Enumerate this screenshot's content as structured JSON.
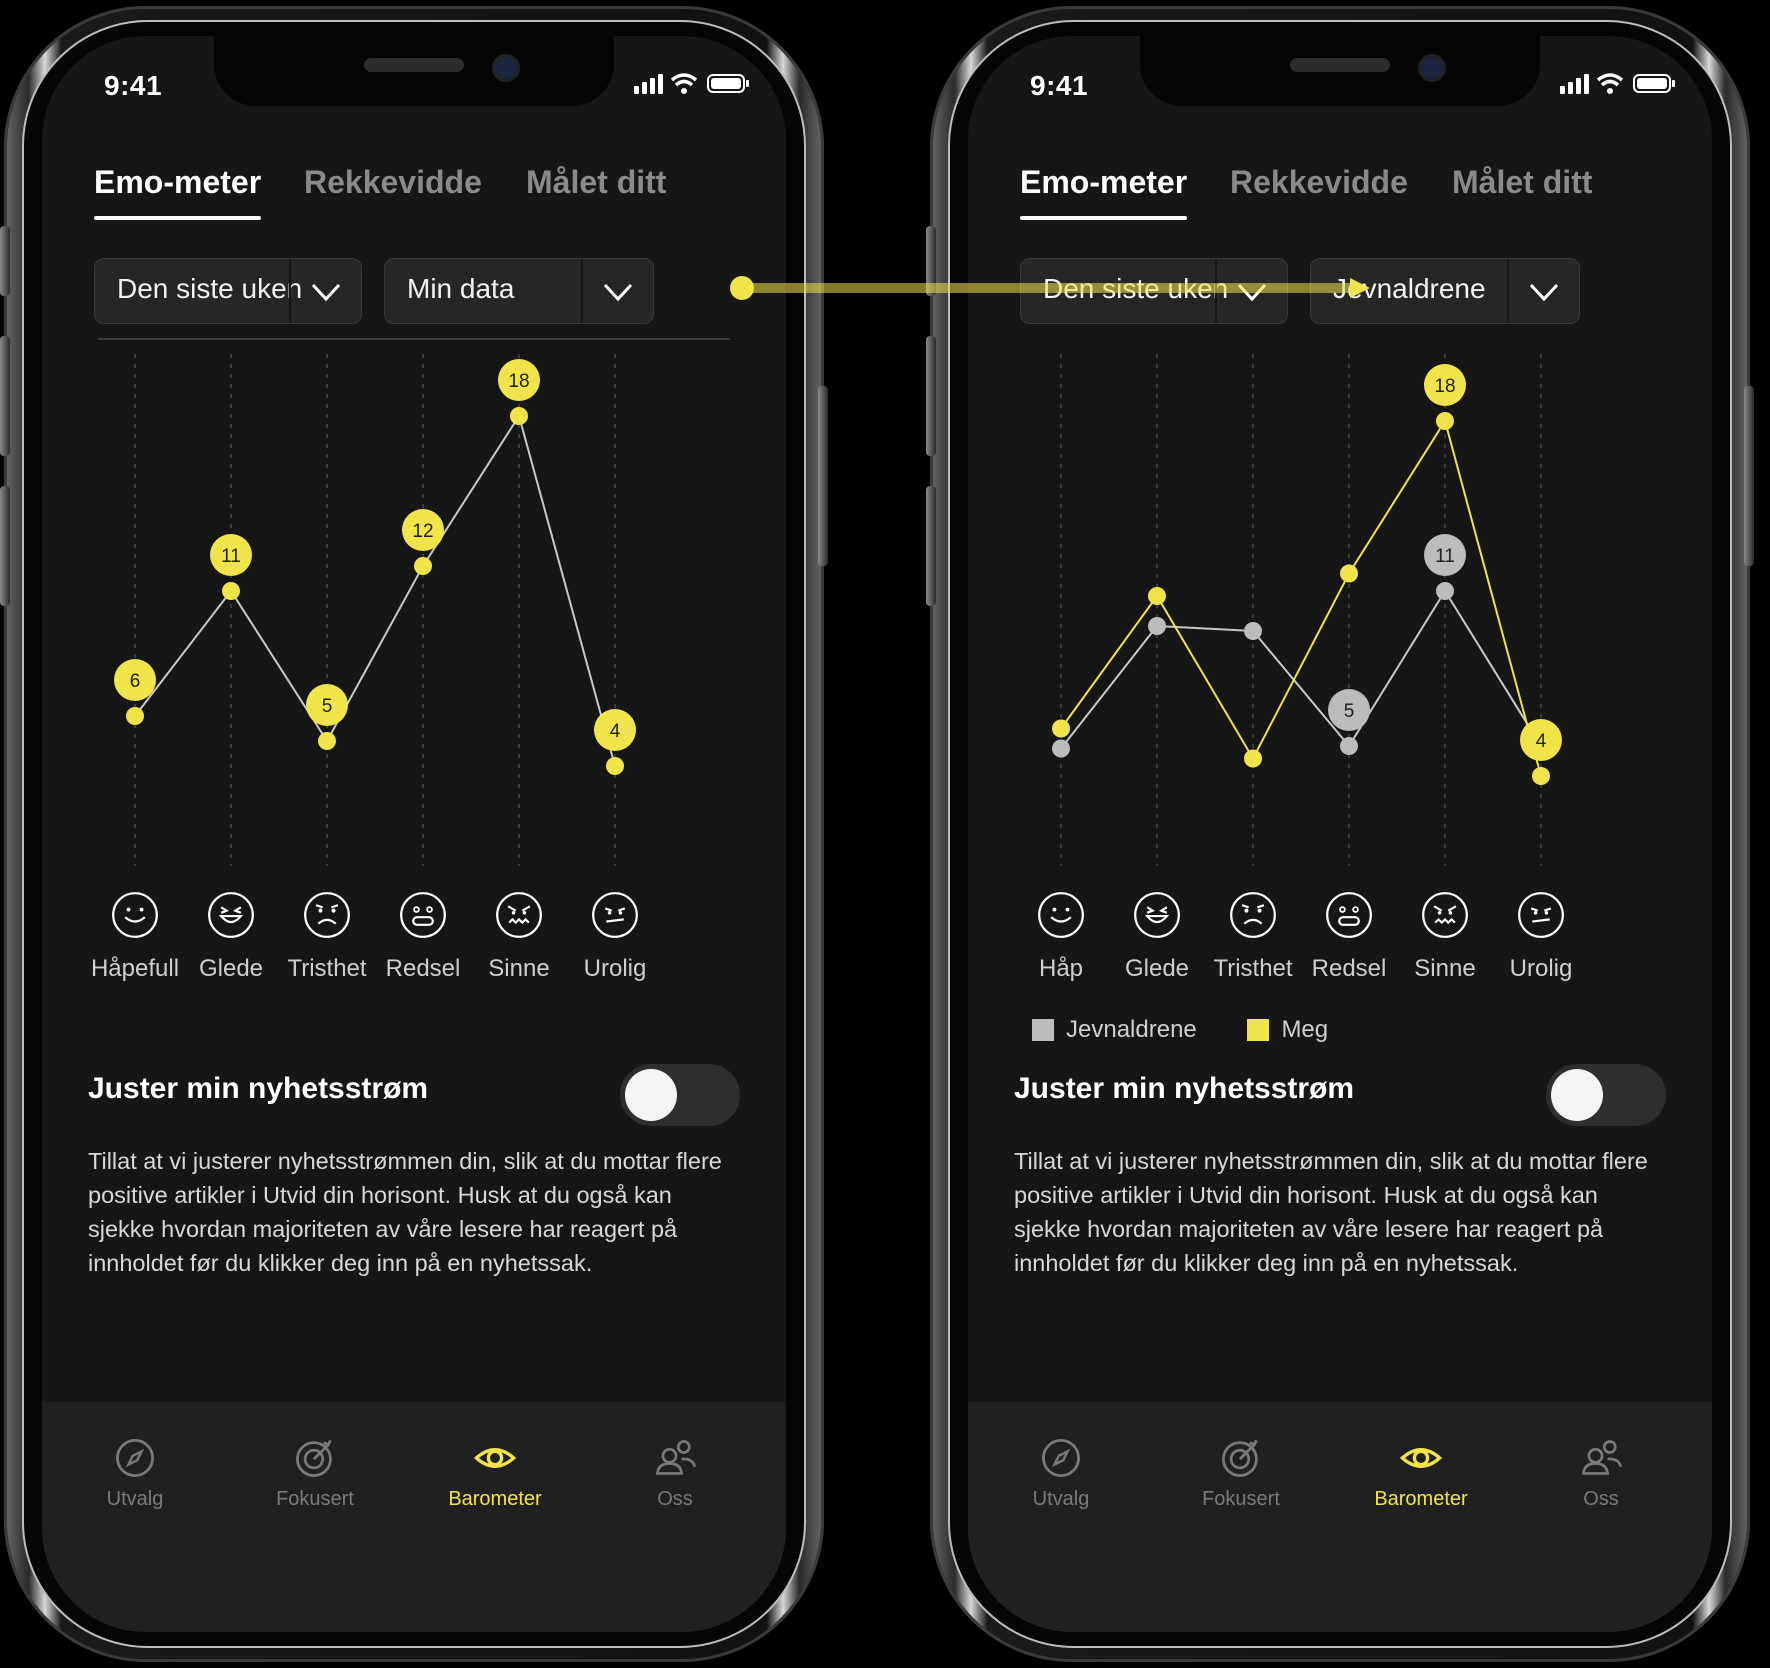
{
  "status": {
    "time": "9:41"
  },
  "tabs": [
    "Emo-meter",
    "Rekkevidde",
    "Målet ditt"
  ],
  "colors": {
    "accent": "#f0e44a",
    "peer": "#bcbcbc",
    "line": "#c8c8c8",
    "background": "#161616"
  },
  "left": {
    "period_select": "Den siste uken",
    "data_select": "Min data",
    "emotions": [
      "Håpefull",
      "Glede",
      "Tristhet",
      "Redsel",
      "Sinne",
      "Urolig"
    ],
    "emotion_icons": [
      "smile-icon",
      "laugh-icon",
      "sad-icon",
      "fear-icon",
      "angry-icon",
      "worried-icon"
    ]
  },
  "right": {
    "period_select": "Den siste uken",
    "data_select": "Jevnaldrene",
    "emotions": [
      "Håp",
      "Glede",
      "Tristhet",
      "Redsel",
      "Sinne",
      "Urolig"
    ],
    "emotion_icons": [
      "smile-icon",
      "laugh-icon",
      "sad-icon",
      "fear-icon",
      "angry-icon",
      "worried-icon"
    ],
    "legend": [
      "Jevnaldrene",
      "Meg"
    ]
  },
  "chart_data": [
    {
      "type": "line",
      "categories": [
        "Håpefull",
        "Glede",
        "Tristhet",
        "Redsel",
        "Sinne",
        "Urolig"
      ],
      "series": [
        {
          "values": [
            6,
            11,
            5,
            12,
            18,
            4
          ],
          "color": "#f0e44a"
        }
      ],
      "data_labels": [
        6,
        11,
        5,
        12,
        18,
        4
      ],
      "grid": "vertical dashed",
      "legend": "none"
    },
    {
      "type": "line",
      "categories": [
        "Håp",
        "Glede",
        "Tristhet",
        "Redsel",
        "Sinne",
        "Urolig"
      ],
      "series": [
        {
          "name": "Meg",
          "values": [
            5.5,
            10.8,
            4.3,
            11.7,
            17.8,
            3.6
          ],
          "color": "#f0e44a"
        },
        {
          "name": "Jevnaldrene",
          "values": [
            4.7,
            9.6,
            9.4,
            4.8,
            11,
            4.8
          ],
          "color": "#bcbcbc"
        }
      ],
      "data_labels": {
        "Meg": {
          "Sinne": 18,
          "Urolig": 4
        },
        "Jevnaldrene": {
          "Redsel": 5,
          "Sinne": 11
        }
      },
      "grid": "vertical dashed",
      "legend": "bottom-left"
    }
  ],
  "adjust": {
    "title": "Juster min nyhetsstrøm",
    "toggle_on": false,
    "description": "Tillat at vi justerer nyhetsstrømmen din, slik at du mottar flere positive artikler i Utvid din horisont. Husk at du også kan sjekke hvordan majoriteten av våre lesere har reagert på innholdet før du klikker deg inn på en nyhetssak."
  },
  "nav": [
    {
      "label": "Utvalg",
      "icon": "compass-icon",
      "active": false
    },
    {
      "label": "Fokusert",
      "icon": "target-icon",
      "active": false
    },
    {
      "label": "Barometer",
      "icon": "eye-icon",
      "active": true
    },
    {
      "label": "Oss",
      "icon": "users-icon",
      "active": false
    }
  ]
}
